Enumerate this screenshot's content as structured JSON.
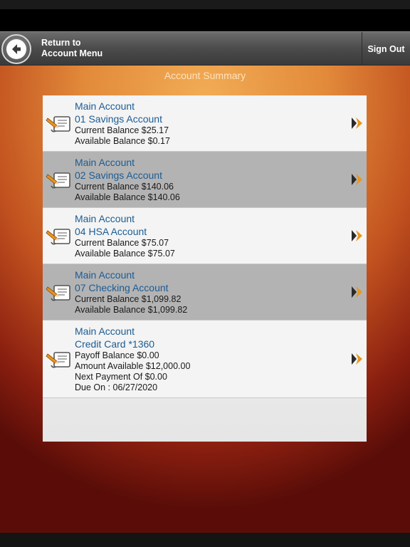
{
  "header": {
    "return_line1": "Return to",
    "return_line2": "Account Menu",
    "sign_out": "Sign Out"
  },
  "page_title": "Account Summary",
  "accounts": [
    {
      "group": "Main Account",
      "name": "01 Savings Account",
      "lines": [
        "Current Balance $25.17",
        "Available Balance $0.17"
      ]
    },
    {
      "group": "Main Account",
      "name": "02 Savings Account",
      "lines": [
        "Current Balance $140.06",
        "Available Balance $140.06"
      ]
    },
    {
      "group": "Main Account",
      "name": "04 HSA Account",
      "lines": [
        "Current Balance $75.07",
        "Available Balance $75.07"
      ]
    },
    {
      "group": "Main Account",
      "name": "07 Checking Account",
      "lines": [
        "Current Balance $1,099.82",
        "Available Balance $1,099.82"
      ]
    },
    {
      "group": "Main Account",
      "name": "Credit Card *1360",
      "lines": [
        "Payoff Balance $0.00",
        "Amount Available $12,000.00",
        "Next Payment Of $0.00",
        "Due On : 06/27/2020"
      ]
    }
  ],
  "icons": {
    "back": "back-arrow-icon",
    "account": "pencil-document-icon",
    "chevron": "chevron-right-icon"
  },
  "colors": {
    "link_blue": "#1c5c94",
    "chevron_orange": "#e8961e"
  }
}
